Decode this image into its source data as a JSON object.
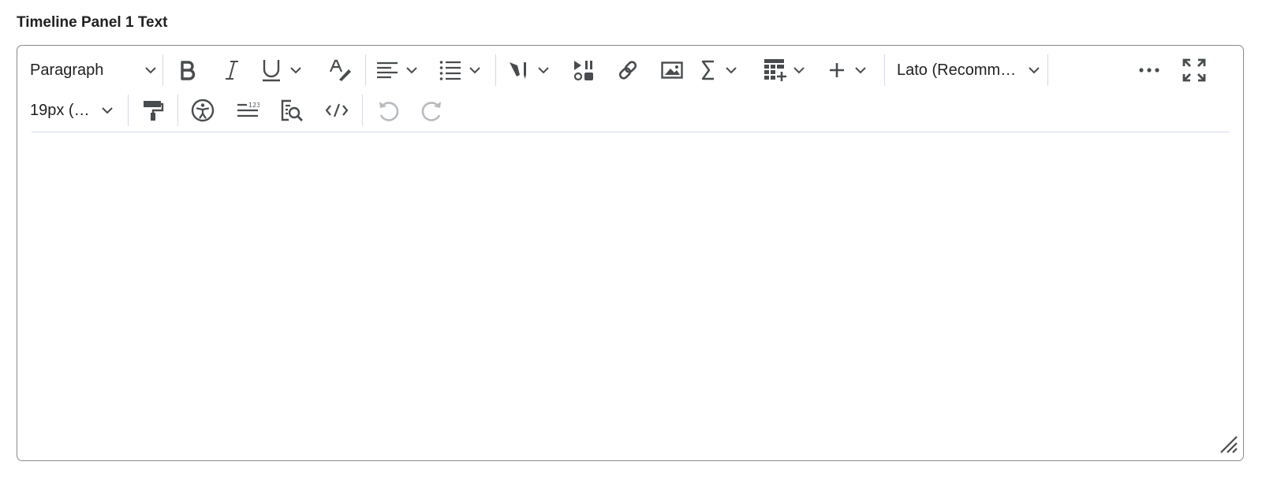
{
  "field": {
    "label": "Timeline Panel 1 Text"
  },
  "toolbar": {
    "block_format": "Paragraph",
    "font_family": "Lato (Recomm…",
    "font_size": "19px (…"
  },
  "editor": {
    "content": ""
  },
  "colors": {
    "icon": "#494c4e",
    "border": "#868b8f",
    "separator": "#d3d9e3",
    "disabled": "#b7bbbf"
  }
}
